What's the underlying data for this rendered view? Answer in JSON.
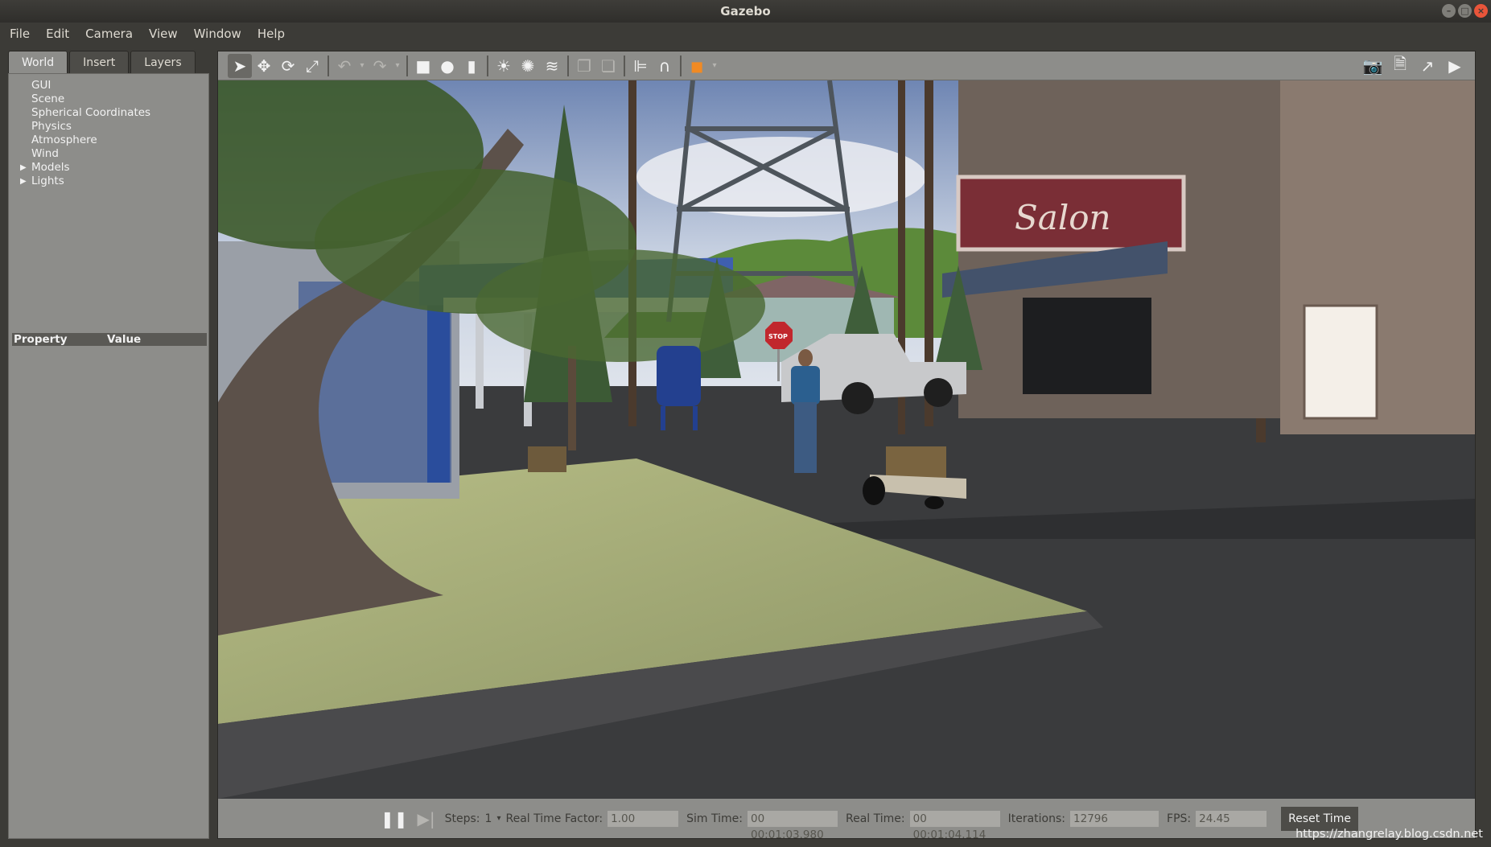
{
  "window": {
    "title": "Gazebo"
  },
  "menu": [
    "File",
    "Edit",
    "Camera",
    "View",
    "Window",
    "Help"
  ],
  "tabs": [
    "World",
    "Insert",
    "Layers"
  ],
  "tree": [
    {
      "label": "GUI",
      "expandable": false
    },
    {
      "label": "Scene",
      "expandable": false
    },
    {
      "label": "Spherical Coordinates",
      "expandable": false
    },
    {
      "label": "Physics",
      "expandable": false
    },
    {
      "label": "Atmosphere",
      "expandable": false
    },
    {
      "label": "Wind",
      "expandable": false
    },
    {
      "label": "Models",
      "expandable": true
    },
    {
      "label": "Lights",
      "expandable": true
    }
  ],
  "properties": {
    "col1": "Property",
    "col2": "Value"
  },
  "scene": {
    "sign_text": "Salon",
    "stop_text": "STOP"
  },
  "bottom": {
    "steps_label": "Steps:",
    "steps_value": "1",
    "rtf_label": "Real Time Factor:",
    "rtf_value": "1.00",
    "simtime_label": "Sim Time:",
    "simtime_value": "00 00:01:03.980",
    "realtime_label": "Real Time:",
    "realtime_value": "00 00:01:04.114",
    "iter_label": "Iterations:",
    "iter_value": "12796",
    "fps_label": "FPS:",
    "fps_value": "24.45",
    "reset_label": "Reset Time"
  },
  "watermark": "https://zhangrelay.blog.csdn.net",
  "colors": {
    "panel": "#8d8d8a",
    "chrome": "#3c3b37",
    "close": "#e9553a"
  }
}
